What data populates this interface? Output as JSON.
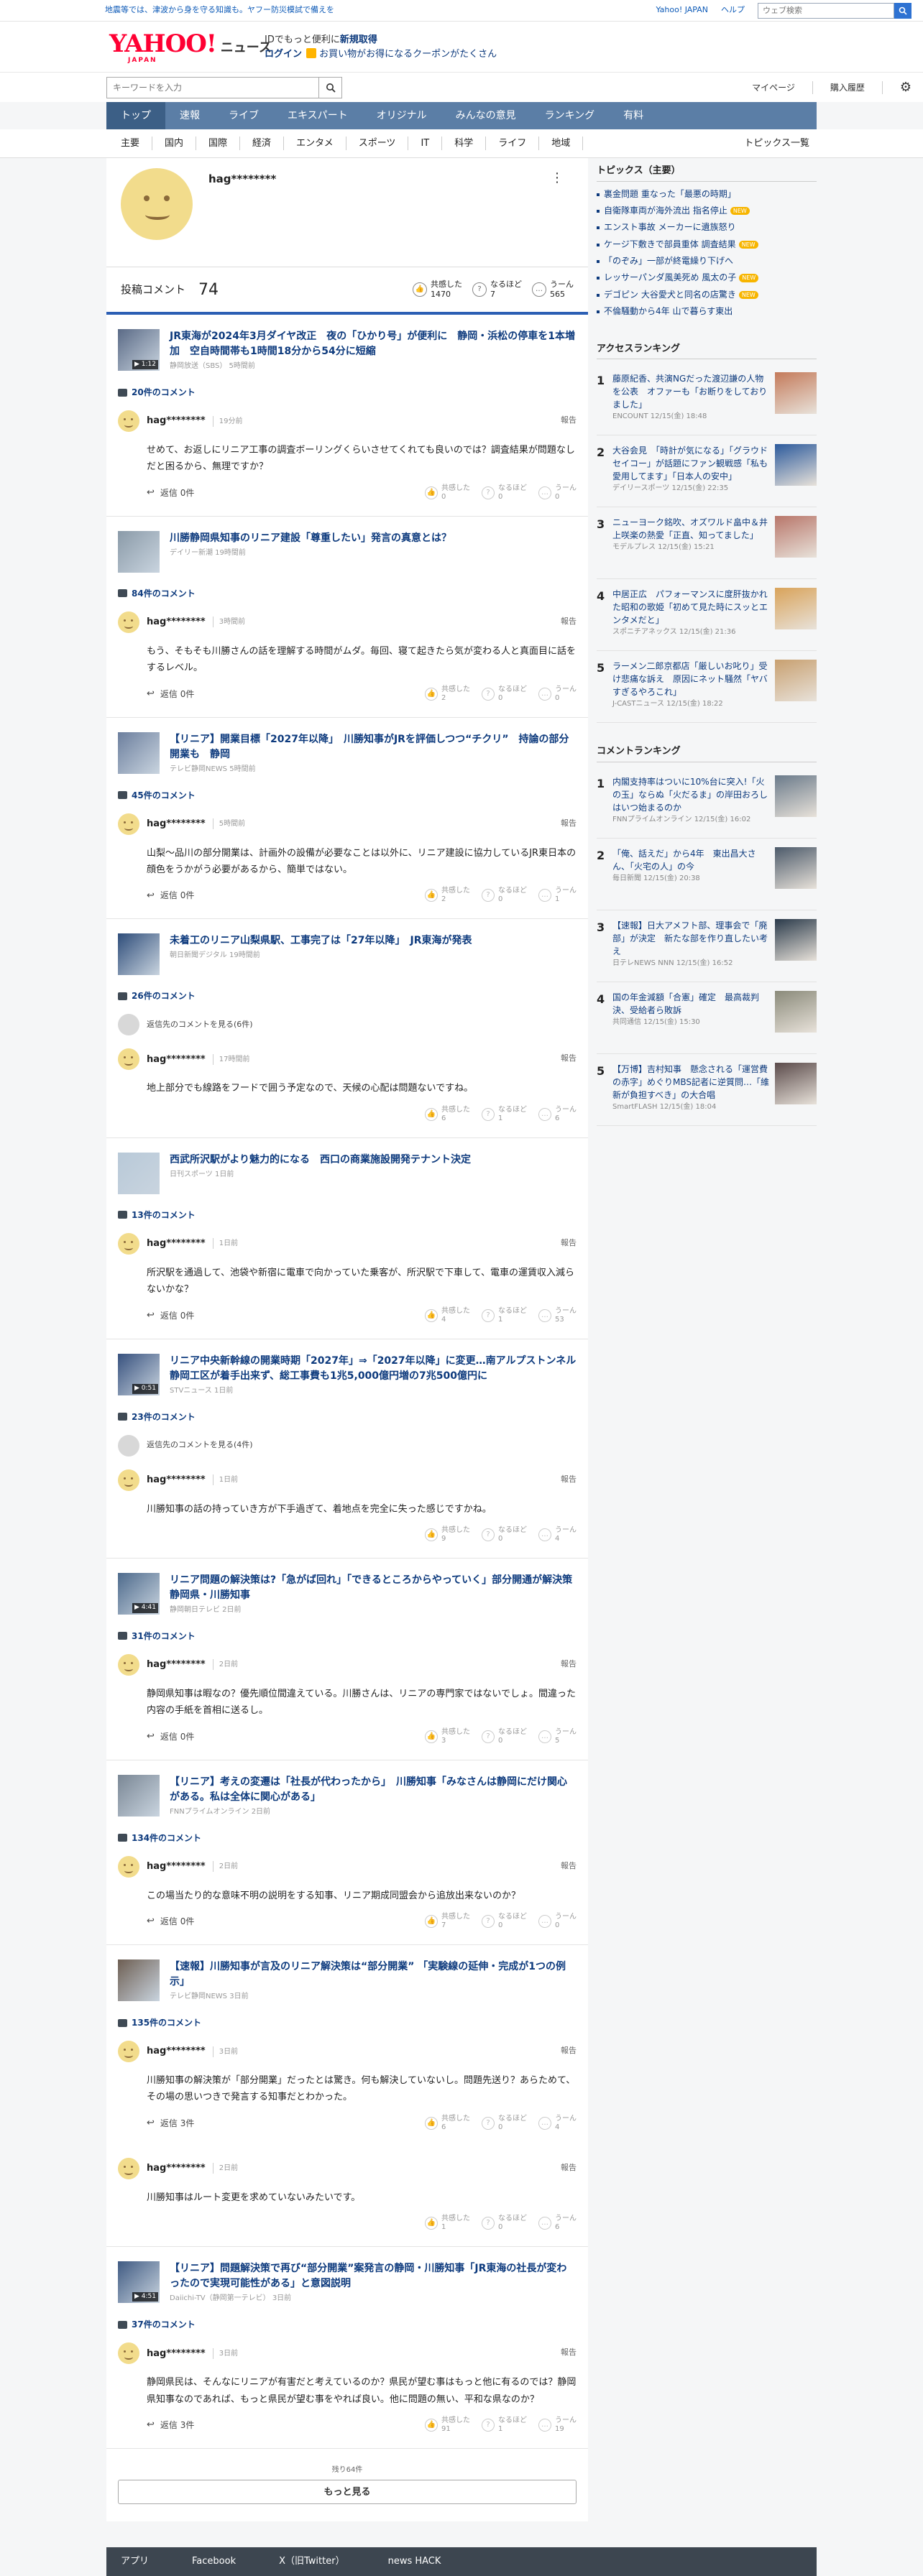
{
  "topbar": {
    "notice": "地震等では、津波から身を守る知識も。ヤフー防災模試で備えを",
    "links": [
      "Yahoo! JAPAN",
      "ヘルプ"
    ],
    "search_placeholder": "ウェブ検索"
  },
  "header": {
    "logo_text": "YAHOO!",
    "logo_sub": "JAPAN",
    "section": "ニュース",
    "login_line1_pre": "IDでもっと便利に",
    "login_line1_link": "新規取得",
    "login_line2_link": "ログイン",
    "login_line2_coupon": "お買い物がお得になるクーポンがたくさん"
  },
  "subheader": {
    "search_placeholder": "キーワードを入力",
    "links": [
      "マイページ",
      "購入履歴"
    ]
  },
  "nav": [
    "トップ",
    "速報",
    "ライブ",
    "エキスパート",
    "オリジナル",
    "みんなの意見",
    "ランキング",
    "有料"
  ],
  "categories": [
    "主要",
    "国内",
    "国際",
    "経済",
    "エンタメ",
    "スポーツ",
    "IT",
    "科学",
    "ライフ",
    "地域"
  ],
  "categories_all": "トピックス一覧",
  "profile": {
    "username": "hag********",
    "menu": "⋮",
    "comments_label": "投稿コメント",
    "comments_count": "74",
    "reactions": [
      {
        "icon": "thumb-icon",
        "label": "共感した",
        "count": "1470"
      },
      {
        "icon": "bulb-icon",
        "label": "なるほど",
        "count": "7"
      },
      {
        "icon": "hmm-icon",
        "label": "うーん",
        "count": "565"
      }
    ]
  },
  "labels": {
    "reply": "返信",
    "report": "報告",
    "parent_link": "返信先のコメントを見る",
    "react_empathy": "共感した",
    "react_naruhodo": "なるほど",
    "react_hmm": "うーん"
  },
  "items": [
    {
      "title": "JR東海が2024年3月ダイヤ改正　夜の「ひかり号」が便利に　静岡・浜松の停車を1本増加　空自時間帯も1時間18分から54分に短縮",
      "source": "静岡放送（SBS）  5時間前",
      "thumb_badge": "▶ 1:12",
      "comment_count": "20件のコメント",
      "parent": "",
      "comment": {
        "name": "hag********",
        "time": "19分前",
        "body": "せめて、お返しにリニア工事の調査ボーリングくらいさせてくれても良いのでは？調査結果が問題なしだと困るから、無理ですか？",
        "reply": "返信 0件",
        "e": "0",
        "n": "0",
        "h": "0"
      }
    },
    {
      "title": "川勝静岡県知事のリニア建設「尊重したい」発言の真意とは？",
      "source": "デイリー新潮  19時間前",
      "thumb_badge": "",
      "comment_count": "84件のコメント",
      "parent": "",
      "comment": {
        "name": "hag********",
        "time": "3時間前",
        "body": "もう、そもそも川勝さんの話を理解する時間がムダ。毎回、寝て起きたら気が変わる人と真面目に話をするレベル。",
        "reply": "返信 0件",
        "e": "2",
        "n": "0",
        "h": "0"
      }
    },
    {
      "title": "【リニア】開業目標「2027年以降」　川勝知事がJRを評価しつつ“チクリ”　持論の部分開業も　静岡",
      "source": "テレビ静岡NEWS  5時間前",
      "thumb_badge": "",
      "comment_count": "45件のコメント",
      "parent": "",
      "comment": {
        "name": "hag********",
        "time": "5時間前",
        "body": "山梨〜品川の部分開業は、計画外の設備が必要なことは以外に、リニア建設に協力しているJR東日本の顔色をうかがう必要があるから、簡単ではない。",
        "reply": "返信 0件",
        "e": "2",
        "n": "0",
        "h": "1"
      }
    },
    {
      "title": "未着工のリニア山梨県駅、工事完了は「27年以降」　JR東海が発表",
      "source": "朝日新聞デジタル  19時間前",
      "thumb_badge": "",
      "comment_count": "26件のコメント",
      "parent": "返信先のコメントを見る(6件)",
      "comment": {
        "name": "hag********",
        "time": "17時間前",
        "body": "地上部分でも線路をフードで囲う予定なので、天候の心配は問題ないですね。",
        "reply": "",
        "e": "6",
        "n": "1",
        "h": "6"
      }
    },
    {
      "title": "西武所沢駅がより魅力的になる　西口の商業施設開発テナント決定",
      "source": "日刊スポーツ  1日前",
      "thumb_badge": "",
      "comment_count": "13件のコメント",
      "parent": "",
      "comment": {
        "name": "hag********",
        "time": "1日前",
        "body": "所沢駅を通過して、池袋や新宿に電車で向かっていた乗客が、所沢駅で下車して、電車の運賃収入減らないかな？",
        "reply": "返信 0件",
        "e": "4",
        "n": "1",
        "h": "53"
      }
    },
    {
      "title": "リニア中央新幹線の開業時期「2027年」⇒「2027年以降」に変更…南アルプストンネル静岡工区が着手出来ず、総工事費も1兆5,000億円増の7兆500億円に",
      "source": "STVニュース  1日前",
      "thumb_badge": "▶ 0:51",
      "comment_count": "23件のコメント",
      "parent": "返信先のコメントを見る(4件)",
      "comment": {
        "name": "hag********",
        "time": "1日前",
        "body": "川勝知事の話の持っていき方が下手過ぎて、着地点を完全に失った感じですかね。",
        "reply": "",
        "e": "9",
        "n": "0",
        "h": "4"
      }
    },
    {
      "title": "リニア問題の解決策は?「急がば回れ」「できるところからやっていく」部分開通が解決策 静岡県・川勝知事",
      "source": "静岡朝日テレビ  2日前",
      "thumb_badge": "▶ 4:41",
      "comment_count": "31件のコメント",
      "parent": "",
      "comment": {
        "name": "hag********",
        "time": "2日前",
        "body": "静岡県知事は暇なの？優先順位間違えている。川勝さんは、リニアの専門家ではないでしょ。間違った内容の手紙を首相に送るし。",
        "reply": "返信 0件",
        "e": "3",
        "n": "0",
        "h": "5"
      }
    },
    {
      "title": "【リニア】考えの変遷は「社長が代わったから」　川勝知事「みなさんは静岡にだけ関心がある。私は全体に関心がある」",
      "source": "FNNプライムオンライン  2日前",
      "thumb_badge": "",
      "comment_count": "134件のコメント",
      "parent": "",
      "comment": {
        "name": "hag********",
        "time": "2日前",
        "body": "この場当たり的な意味不明の説明をする知事、リニア期成同盟会から追放出来ないのか？",
        "reply": "返信 0件",
        "e": "7",
        "n": "0",
        "h": "0"
      }
    },
    {
      "title": "【速報】川勝知事が言及のリニア解決策は“部分開業” 「実験線の延伸・完成が1つの例示」",
      "source": "テレビ静岡NEWS  3日前",
      "thumb_badge": "",
      "comment_count": "135件のコメント",
      "parent": "",
      "comment": {
        "name": "hag********",
        "time": "3日前",
        "body": "川勝知事の解決策が「部分開業」だったとは驚き。何も解決していないし。問題先送り？あらためて、その場の思いつきで発言する知事だとわかった。",
        "reply": "返信 3件",
        "e": "6",
        "n": "0",
        "h": "4"
      },
      "comment2": {
        "name": "hag********",
        "time": "2日前",
        "body": "川勝知事はルート変更を求めていないみたいです。",
        "reply": "",
        "e": "1",
        "n": "0",
        "h": "6"
      }
    },
    {
      "title": "【リニア】問題解決策で再び“部分開業”案発言の静岡・川勝知事「JR東海の社長が変わったので実現可能性がある」と意図説明",
      "source": "Daiichi-TV（静岡第一テレビ）  3日前",
      "thumb_badge": "▶ 4:51",
      "comment_count": "37件のコメント",
      "parent": "",
      "comment": {
        "name": "hag********",
        "time": "3日前",
        "body": "静岡県民は、そんなにリニアが有害だと考えているのか？県民が望む事はもっと他に有るのでは？静岡県知事なのであれば、もっと県民が望む事をやれば良い。他に問題の無い、平和な県なのか？",
        "reply": "返信 3件",
        "e": "91",
        "n": "1",
        "h": "19"
      }
    }
  ],
  "more": {
    "remaining": "残り64件",
    "button": "もっと見る"
  },
  "sidebar": {
    "topics_title": "トピックス（主要）",
    "topics": [
      {
        "text": "裏金問題 重なった「最悪の時期」",
        "new": ""
      },
      {
        "text": "自衛隊車両が海外流出 指名停止",
        "new": "NEW"
      },
      {
        "text": "エンスト事故 メーカーに遺族怒り",
        "new": ""
      },
      {
        "text": "ケージ下敷きで部員重体 調査結果",
        "new": "NEW"
      },
      {
        "text": "「のぞみ」一部が終電繰り下げへ",
        "new": ""
      },
      {
        "text": "レッサーパンダ風美死め 風太の子",
        "new": "NEW"
      },
      {
        "text": "デゴピン 大谷愛犬と同名の店驚き",
        "new": "NEW"
      },
      {
        "text": "不倫騒動から4年 山で暮らす東出",
        "new": ""
      }
    ],
    "access_title": "アクセスランキング",
    "access": [
      {
        "n": "1",
        "text": "藤原紀香、共演NGだった渡辺謙の人物を公表　オファーも「お断りをしておりました」",
        "src": "ENCOUNT 12/15(金) 18:48"
      },
      {
        "n": "2",
        "text": "大谷会見　「時計が気になる」「グラウドセイコー」が話題にファン観戦感「私も愛用してます」「日本人の安中」",
        "src": "デイリースポーツ 12/15(金) 22:35"
      },
      {
        "n": "3",
        "text": "ニューヨーク銘吹、オズワルド畠中＆井上咲楽の熱愛「正直、知ってました」",
        "src": "モデルプレス 12/15(金) 15:21"
      },
      {
        "n": "4",
        "text": "中居正広　パフォーマンスに度肝抜かれた昭和の歌姫「初めて見た時にスッとエンタメだと」",
        "src": "スポニチアネックス 12/15(金) 21:36"
      },
      {
        "n": "5",
        "text": "ラーメン二郎京都店「厳しいお叱り」受け悲痛な訴え　原因にネット騒然「ヤバすぎるやろこれ」",
        "src": "J-CASTニュース 12/15(金) 18:22"
      }
    ],
    "comment_title": "コメントランキング",
    "comment_rank": [
      {
        "n": "1",
        "text": "内閣支持率はついに10%台に突入!「火の玉」ならぬ「火だるま」の岸田おろしはいつ始まるのか",
        "src": "FNNプライムオンライン 12/15(金) 16:02"
      },
      {
        "n": "2",
        "text": "「俺、話えだ」から4年　東出昌大さん、「火宅の人」の今",
        "src": "毎日新聞 12/15(金) 20:38"
      },
      {
        "n": "3",
        "text": "【速報】日大アメフト部、理事会で「廃部」が決定　新たな部を作り直したい考え",
        "src": "日テレNEWS NNN 12/15(金) 16:52"
      },
      {
        "n": "4",
        "text": "国の年金減額「合憲」確定　最高裁判決、受給者ら敗訴",
        "src": "共同通信 12/15(金) 15:30"
      },
      {
        "n": "5",
        "text": "【万博】吉村知事　懸念される「運営費の赤字」めぐりMBS記者に逆質問…「維新が負担すべき」の大合唱",
        "src": "SmartFLASH 12/15(金) 18:04"
      }
    ]
  },
  "footer": [
    "アプリ",
    "Facebook",
    "X（旧Twitter）",
    "news HACK"
  ],
  "colors": {
    "nav": "#5b7ea6",
    "nav_active": "#3c5f86",
    "link": "#0d3a7d",
    "accent": "#2c5fb4",
    "new_badge": "#f7b500"
  }
}
